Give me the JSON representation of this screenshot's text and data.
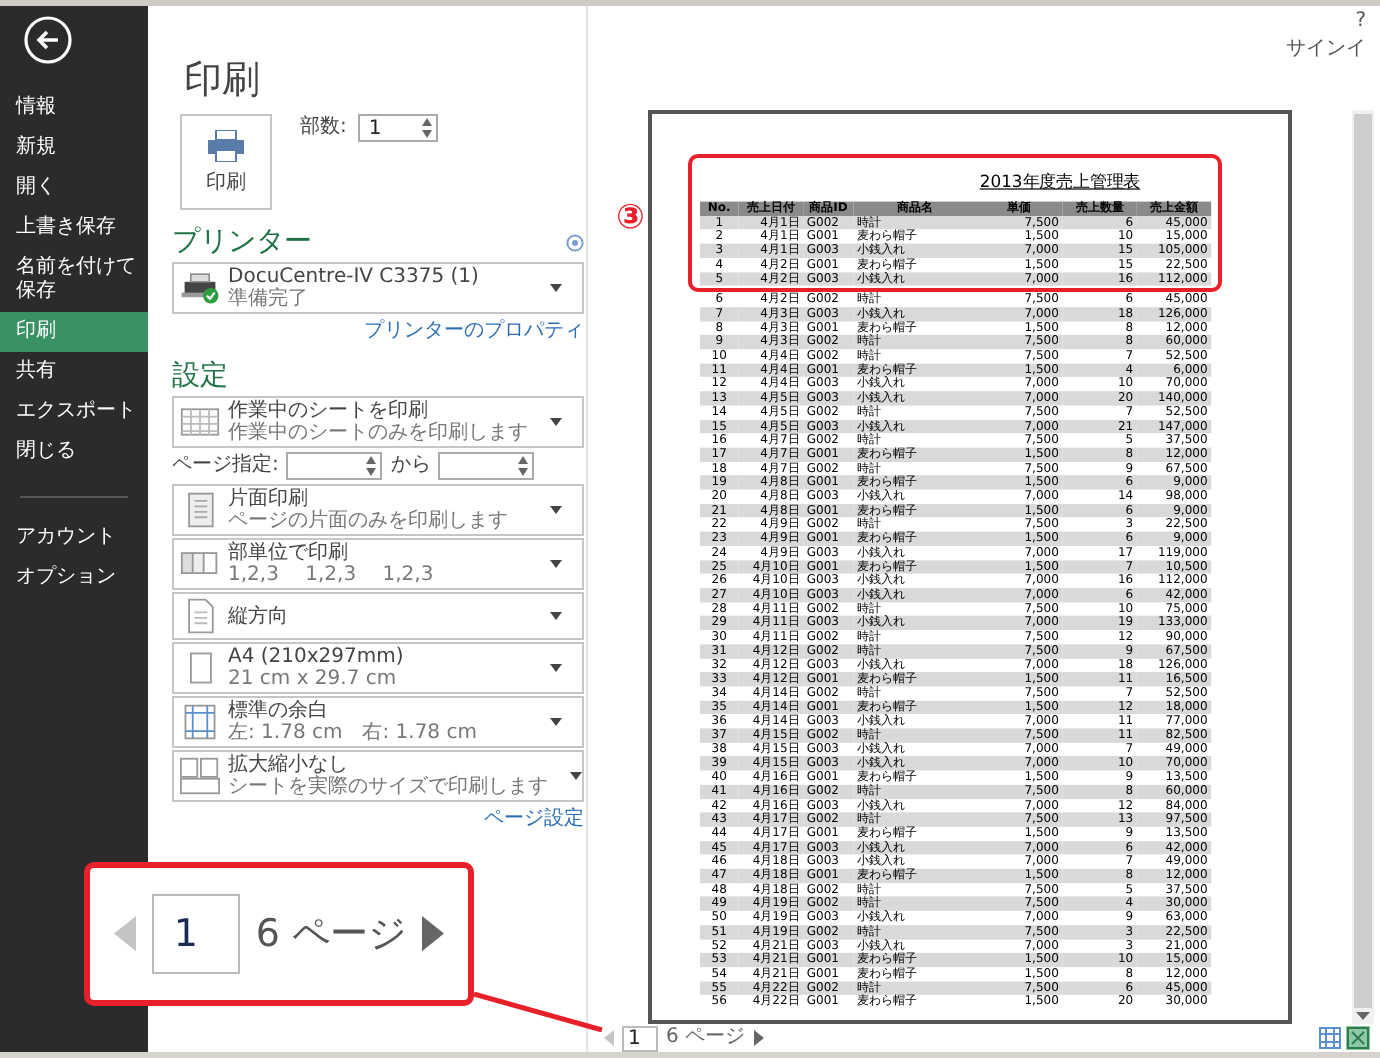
{
  "header": {
    "help": "?",
    "account": "サインイ"
  },
  "sidebar": {
    "items": [
      {
        "label": "情報",
        "selected": false
      },
      {
        "label": "新規",
        "selected": false
      },
      {
        "label": "開く",
        "selected": false
      },
      {
        "label": "上書き保存",
        "selected": false
      },
      {
        "label": "名前を付けて保存",
        "selected": false
      },
      {
        "label": "印刷",
        "selected": true
      },
      {
        "label": "共有",
        "selected": false
      },
      {
        "label": "エクスポート",
        "selected": false
      },
      {
        "label": "閉じる",
        "selected": false
      }
    ],
    "footer_items": [
      {
        "label": "アカウント",
        "selected": false
      },
      {
        "label": "オプション",
        "selected": false
      }
    ]
  },
  "print": {
    "title": "印刷",
    "print_button": "印刷",
    "copies_label": "部数:",
    "copies": "1"
  },
  "printer": {
    "heading": "プリンター",
    "name": "DocuCentre-IV C3375 (1)",
    "status": "準備完了",
    "properties_link": "プリンターのプロパティ"
  },
  "settings": {
    "heading": "設定",
    "options": [
      {
        "kind": "sheet",
        "title": "作業中のシートを印刷",
        "detail": "作業中のシートのみを印刷します"
      },
      {
        "kind": "sides",
        "title": "片面印刷",
        "detail": "ページの片面のみを印刷します"
      },
      {
        "kind": "collate",
        "title": "部単位で印刷",
        "detail": "1,2,3　 1,2,3　 1,2,3"
      },
      {
        "kind": "orientation",
        "title": "縦方向"
      },
      {
        "kind": "paper",
        "title": "A4 (210x297mm)",
        "detail": "21 cm x 29.7 cm"
      },
      {
        "kind": "margins",
        "title": "標準の余白",
        "detail": "左: 1.78 cm　右: 1.78 cm"
      },
      {
        "kind": "scaling",
        "title": "拡大縮小なし",
        "detail": "シートを実際のサイズで印刷します"
      }
    ],
    "page_range": {
      "label": "ページ指定:",
      "to": "から"
    },
    "page_setup_link": "ページ設定"
  },
  "preview": {
    "document": {
      "title": "2013年度売上管理表",
      "columns": [
        "No.",
        "売上日付",
        "商品ID",
        "商品名",
        "単価",
        "売上数量",
        "売上金額"
      ],
      "rows": [
        [
          "1",
          "4月1日",
          "G002",
          "時計",
          "7,500",
          "6",
          "45,000"
        ],
        [
          "2",
          "4月1日",
          "G001",
          "麦わら帽子",
          "1,500",
          "10",
          "15,000"
        ],
        [
          "3",
          "4月1日",
          "G003",
          "小銭入れ",
          "7,000",
          "15",
          "105,000"
        ],
        [
          "4",
          "4月2日",
          "G001",
          "麦わら帽子",
          "1,500",
          "15",
          "22,500"
        ],
        [
          "5",
          "4月2日",
          "G003",
          "小銭入れ",
          "7,000",
          "16",
          "112,000"
        ],
        [
          "6",
          "4月2日",
          "G002",
          "時計",
          "7,500",
          "6",
          "45,000"
        ],
        [
          "7",
          "4月3日",
          "G003",
          "小銭入れ",
          "7,000",
          "18",
          "126,000"
        ],
        [
          "8",
          "4月3日",
          "G001",
          "麦わら帽子",
          "1,500",
          "8",
          "12,000"
        ],
        [
          "9",
          "4月3日",
          "G002",
          "時計",
          "7,500",
          "8",
          "60,000"
        ],
        [
          "10",
          "4月4日",
          "G002",
          "時計",
          "7,500",
          "7",
          "52,500"
        ],
        [
          "11",
          "4月4日",
          "G001",
          "麦わら帽子",
          "1,500",
          "4",
          "6,000"
        ],
        [
          "12",
          "4月4日",
          "G003",
          "小銭入れ",
          "7,000",
          "10",
          "70,000"
        ],
        [
          "13",
          "4月5日",
          "G003",
          "小銭入れ",
          "7,000",
          "20",
          "140,000"
        ],
        [
          "14",
          "4月5日",
          "G002",
          "時計",
          "7,500",
          "7",
          "52,500"
        ],
        [
          "15",
          "4月5日",
          "G003",
          "小銭入れ",
          "7,000",
          "21",
          "147,000"
        ],
        [
          "16",
          "4月7日",
          "G002",
          "時計",
          "7,500",
          "5",
          "37,500"
        ],
        [
          "17",
          "4月7日",
          "G001",
          "麦わら帽子",
          "1,500",
          "8",
          "12,000"
        ],
        [
          "18",
          "4月7日",
          "G002",
          "時計",
          "7,500",
          "9",
          "67,500"
        ],
        [
          "19",
          "4月8日",
          "G001",
          "麦わら帽子",
          "1,500",
          "6",
          "9,000"
        ],
        [
          "20",
          "4月8日",
          "G003",
          "小銭入れ",
          "7,000",
          "14",
          "98,000"
        ],
        [
          "21",
          "4月8日",
          "G001",
          "麦わら帽子",
          "1,500",
          "6",
          "9,000"
        ],
        [
          "22",
          "4月9日",
          "G002",
          "時計",
          "7,500",
          "3",
          "22,500"
        ],
        [
          "23",
          "4月9日",
          "G001",
          "麦わら帽子",
          "1,500",
          "6",
          "9,000"
        ],
        [
          "24",
          "4月9日",
          "G003",
          "小銭入れ",
          "7,000",
          "17",
          "119,000"
        ],
        [
          "25",
          "4月10日",
          "G001",
          "麦わら帽子",
          "1,500",
          "7",
          "10,500"
        ],
        [
          "26",
          "4月10日",
          "G003",
          "小銭入れ",
          "7,000",
          "16",
          "112,000"
        ],
        [
          "27",
          "4月10日",
          "G003",
          "小銭入れ",
          "7,000",
          "6",
          "42,000"
        ],
        [
          "28",
          "4月11日",
          "G002",
          "時計",
          "7,500",
          "10",
          "75,000"
        ],
        [
          "29",
          "4月11日",
          "G003",
          "小銭入れ",
          "7,000",
          "19",
          "133,000"
        ],
        [
          "30",
          "4月11日",
          "G002",
          "時計",
          "7,500",
          "12",
          "90,000"
        ],
        [
          "31",
          "4月12日",
          "G002",
          "時計",
          "7,500",
          "9",
          "67,500"
        ],
        [
          "32",
          "4月12日",
          "G003",
          "小銭入れ",
          "7,000",
          "18",
          "126,000"
        ],
        [
          "33",
          "4月12日",
          "G001",
          "麦わら帽子",
          "1,500",
          "11",
          "16,500"
        ],
        [
          "34",
          "4月14日",
          "G002",
          "時計",
          "7,500",
          "7",
          "52,500"
        ],
        [
          "35",
          "4月14日",
          "G001",
          "麦わら帽子",
          "1,500",
          "12",
          "18,000"
        ],
        [
          "36",
          "4月14日",
          "G003",
          "小銭入れ",
          "7,000",
          "11",
          "77,000"
        ],
        [
          "37",
          "4月15日",
          "G002",
          "時計",
          "7,500",
          "11",
          "82,500"
        ],
        [
          "38",
          "4月15日",
          "G003",
          "小銭入れ",
          "7,000",
          "7",
          "49,000"
        ],
        [
          "39",
          "4月15日",
          "G003",
          "小銭入れ",
          "7,000",
          "10",
          "70,000"
        ],
        [
          "40",
          "4月16日",
          "G001",
          "麦わら帽子",
          "1,500",
          "9",
          "13,500"
        ],
        [
          "41",
          "4月16日",
          "G002",
          "時計",
          "7,500",
          "8",
          "60,000"
        ],
        [
          "42",
          "4月16日",
          "G003",
          "小銭入れ",
          "7,000",
          "12",
          "84,000"
        ],
        [
          "43",
          "4月17日",
          "G002",
          "時計",
          "7,500",
          "13",
          "97,500"
        ],
        [
          "44",
          "4月17日",
          "G001",
          "麦わら帽子",
          "1,500",
          "9",
          "13,500"
        ],
        [
          "45",
          "4月17日",
          "G003",
          "小銭入れ",
          "7,000",
          "6",
          "42,000"
        ],
        [
          "46",
          "4月18日",
          "G003",
          "小銭入れ",
          "7,000",
          "7",
          "49,000"
        ],
        [
          "47",
          "4月18日",
          "G001",
          "麦わら帽子",
          "1,500",
          "8",
          "12,000"
        ],
        [
          "48",
          "4月18日",
          "G002",
          "時計",
          "7,500",
          "5",
          "37,500"
        ],
        [
          "49",
          "4月19日",
          "G002",
          "時計",
          "7,500",
          "4",
          "30,000"
        ],
        [
          "50",
          "4月19日",
          "G003",
          "小銭入れ",
          "7,000",
          "9",
          "63,000"
        ],
        [
          "51",
          "4月19日",
          "G002",
          "時計",
          "7,500",
          "3",
          "22,500"
        ],
        [
          "52",
          "4月21日",
          "G003",
          "小銭入れ",
          "7,000",
          "3",
          "21,000"
        ],
        [
          "53",
          "4月21日",
          "G001",
          "麦わら帽子",
          "1,500",
          "10",
          "15,000"
        ],
        [
          "54",
          "4月21日",
          "G001",
          "麦わら帽子",
          "1,500",
          "8",
          "12,000"
        ],
        [
          "55",
          "4月22日",
          "G002",
          "時計",
          "7,500",
          "6",
          "45,000"
        ],
        [
          "56",
          "4月22日",
          "G001",
          "麦わら帽子",
          "1,500",
          "20",
          "30,000"
        ]
      ]
    },
    "page_nav": {
      "current": "1",
      "total": "6 ページ"
    },
    "view_buttons": [
      {
        "kind": "margins",
        "selected": false
      },
      {
        "kind": "zoom",
        "selected": true
      }
    ]
  },
  "callout": {
    "marker": "③",
    "page_nav": {
      "current": "1",
      "total": "6 ページ"
    }
  }
}
